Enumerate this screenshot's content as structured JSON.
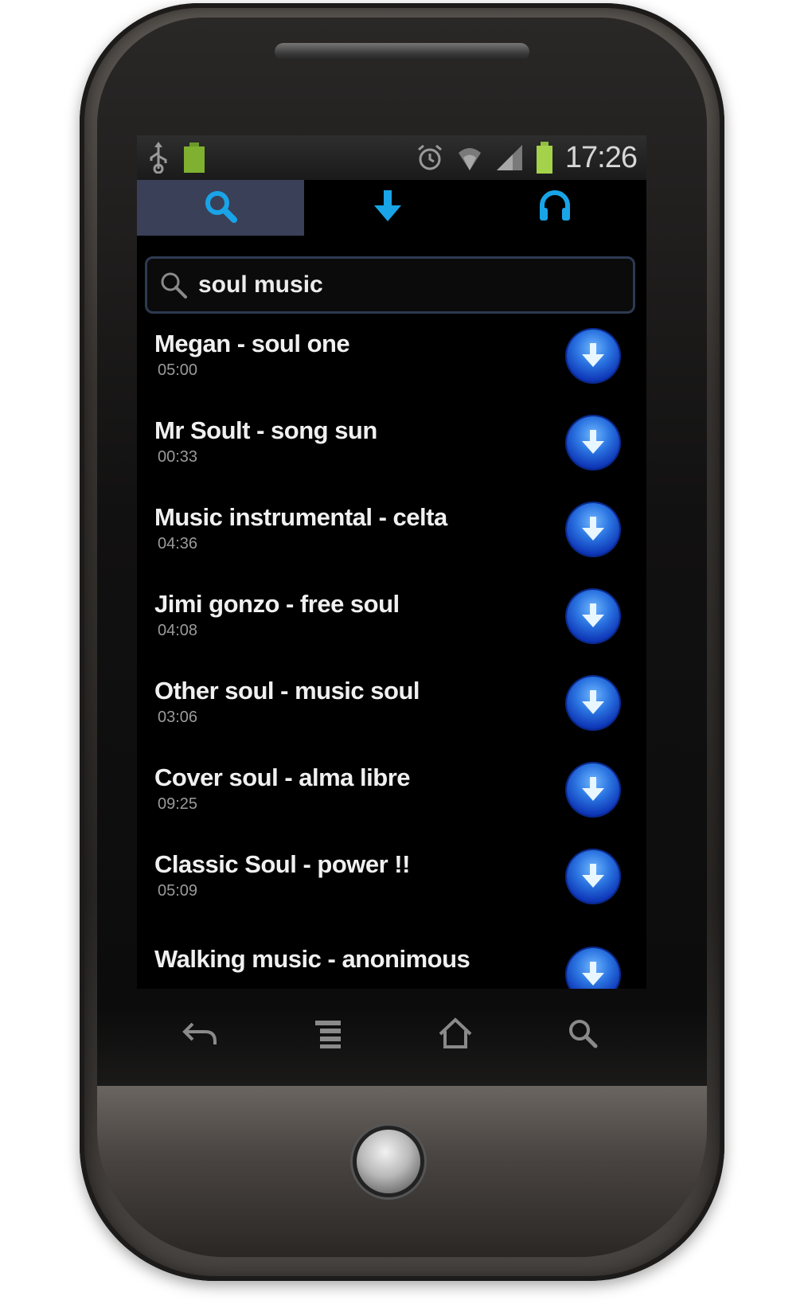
{
  "status_bar": {
    "time": "17:26",
    "left_icons": [
      "usb-icon",
      "battery-notification-icon"
    ],
    "right_icons": [
      "alarm-icon",
      "wifi-icon",
      "signal-icon",
      "battery-icon"
    ]
  },
  "tabs": [
    {
      "icon": "search-icon",
      "selected": true
    },
    {
      "icon": "download-icon",
      "selected": false
    },
    {
      "icon": "headphones-icon",
      "selected": false
    }
  ],
  "search": {
    "value": "soul music"
  },
  "songs": [
    {
      "title": "Megan - soul one",
      "duration": "05:00"
    },
    {
      "title": "Mr Soult - song sun",
      "duration": "00:33"
    },
    {
      "title": "Music instrumental - celta",
      "duration": "04:36"
    },
    {
      "title": "Jimi gonzo - free soul",
      "duration": "04:08"
    },
    {
      "title": "Other soul - music soul",
      "duration": "03:06"
    },
    {
      "title": "Cover soul - alma libre",
      "duration": "09:25"
    },
    {
      "title": "Classic Soul - power !!",
      "duration": "05:09"
    },
    {
      "title": "Walking music - anonimous",
      "duration": ""
    }
  ],
  "nav_buttons": [
    "back-icon",
    "menu-icon",
    "home-icon",
    "search-icon"
  ],
  "colors": {
    "accent": "#19a4e8",
    "tab_selected_bg": "#3a4058",
    "download_button": "#2a73e0"
  }
}
